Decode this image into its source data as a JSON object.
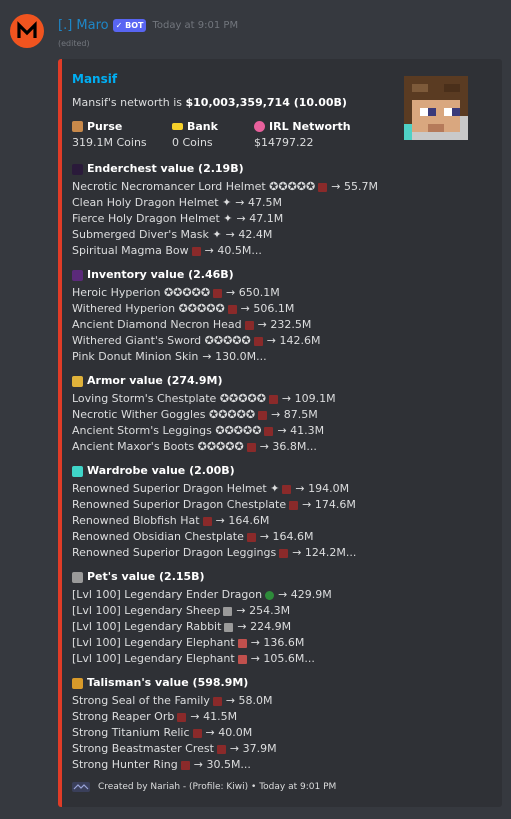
{
  "message": {
    "author": "[.] Maro",
    "bot_tag": "✓ BOT",
    "timestamp": "Today at 9:01 PM",
    "edited": "(edited)"
  },
  "embed": {
    "title": "Mansif",
    "networth_prefix": "Mansif's networth is ",
    "networth_value": "$10,003,359,714",
    "networth_short": " (10.00B)",
    "fields": [
      {
        "name": "Purse",
        "value": "319.1M Coins"
      },
      {
        "name": "Bank",
        "value": "0 Coins"
      },
      {
        "name": "IRL Networth",
        "value": "$14797.22"
      }
    ],
    "sections": [
      {
        "title": "Enderchest value (2.19B)",
        "items": [
          {
            "name": "Necrotic Necromancer Lord Helmet ✪✪✪✪✪",
            "value": "→ 55.7M"
          },
          {
            "name": "Clean Holy Dragon Helmet ✦",
            "value": "→ 47.5M"
          },
          {
            "name": "Fierce Holy Dragon Helmet ✦",
            "value": "→ 47.1M"
          },
          {
            "name": "Submerged Diver's Mask ✦",
            "value": "→ 42.4M"
          },
          {
            "name": "Spiritual Magma Bow",
            "value": "→ 40.5M..."
          }
        ]
      },
      {
        "title": "Inventory value (2.46B)",
        "items": [
          {
            "name": "Heroic Hyperion ✪✪✪✪✪",
            "value": "→ 650.1M"
          },
          {
            "name": "Withered Hyperion ✪✪✪✪✪",
            "value": "→ 506.1M"
          },
          {
            "name": "Ancient Diamond Necron Head",
            "value": "→ 232.5M"
          },
          {
            "name": "Withered Giant's Sword ✪✪✪✪✪",
            "value": "→ 142.6M"
          },
          {
            "name": "Pink Donut Minion Skin",
            "value": "→ 130.0M..."
          }
        ]
      },
      {
        "title": "Armor value (274.9M)",
        "items": [
          {
            "name": "Loving Storm's Chestplate ✪✪✪✪✪",
            "value": "→ 109.1M"
          },
          {
            "name": "Necrotic Wither Goggles ✪✪✪✪✪",
            "value": "→ 87.5M"
          },
          {
            "name": "Ancient Storm's Leggings ✪✪✪✪✪",
            "value": "→ 41.3M"
          },
          {
            "name": "Ancient Maxor's Boots ✪✪✪✪✪",
            "value": "→ 36.8M..."
          }
        ]
      },
      {
        "title": "Wardrobe value (2.00B)",
        "items": [
          {
            "name": "Renowned Superior Dragon Helmet ✦",
            "value": "→ 194.0M"
          },
          {
            "name": "Renowned Superior Dragon Chestplate",
            "value": "→ 174.6M"
          },
          {
            "name": "Renowned Blobfish Hat",
            "value": "→ 164.6M"
          },
          {
            "name": "Renowned Obsidian Chestplate",
            "value": "→ 164.6M"
          },
          {
            "name": "Renowned Superior Dragon Leggings",
            "value": "→ 124.2M..."
          }
        ]
      },
      {
        "title": "Pet's value (2.15B)",
        "items": [
          {
            "name": "[Lvl 100] Legendary Ender Dragon",
            "value": "→ 429.9M"
          },
          {
            "name": "[Lvl 100] Legendary Sheep",
            "value": "→ 254.3M"
          },
          {
            "name": "[Lvl 100] Legendary Rabbit",
            "value": "→ 224.9M"
          },
          {
            "name": "[Lvl 100] Legendary Elephant",
            "value": "→ 136.6M"
          },
          {
            "name": "[Lvl 100] Legendary Elephant",
            "value": "→ 105.6M..."
          }
        ]
      },
      {
        "title": "Talisman's value (598.9M)",
        "items": [
          {
            "name": "Strong Seal of the Family",
            "value": "→ 58.0M"
          },
          {
            "name": "Strong Reaper Orb",
            "value": "→ 41.5M"
          },
          {
            "name": "Strong Titanium Relic",
            "value": "→ 40.0M"
          },
          {
            "name": "Strong Beastmaster Crest",
            "value": "→ 37.9M"
          },
          {
            "name": "Strong Hunter Ring",
            "value": "→ 30.5M..."
          }
        ]
      }
    ],
    "footer": "Created by Nariah - (Profile: Kiwi) • Today at 9:01 PM"
  },
  "colors": {
    "accent": "#e03c27",
    "title": "#00aff4",
    "author": "#1e87c8"
  }
}
